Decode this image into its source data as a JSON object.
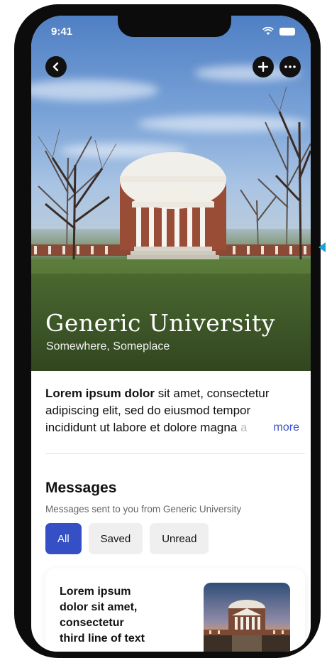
{
  "status_bar": {
    "time": "9:41"
  },
  "hero": {
    "title": "Generic University",
    "subtitle": "Somewhere, Someplace",
    "back_icon": "chevron-left-icon",
    "add_icon": "plus-icon",
    "more_icon": "ellipsis-icon"
  },
  "description": {
    "bold": "Lorem ipsum dolor",
    "line1_rest": " sit amet, consectetur",
    "line2": "adipiscing elit, sed do eiusmod tempor",
    "line3": "incididunt ut labore et dolore magna",
    "line3_fade": " a",
    "more": "more"
  },
  "messages": {
    "heading": "Messages",
    "subtitle": "Messages sent to you from Generic University",
    "filters": [
      {
        "label": "All",
        "active": true
      },
      {
        "label": "Saved",
        "active": false
      },
      {
        "label": "Unread",
        "active": false
      }
    ],
    "card": {
      "lines": [
        "Lorem ipsum",
        "dolor sit amet,",
        "consectetur",
        "third line of text"
      ]
    }
  },
  "colors": {
    "accent": "#3450c4",
    "link": "#3650c7",
    "pointer": "#1aa3d8"
  }
}
